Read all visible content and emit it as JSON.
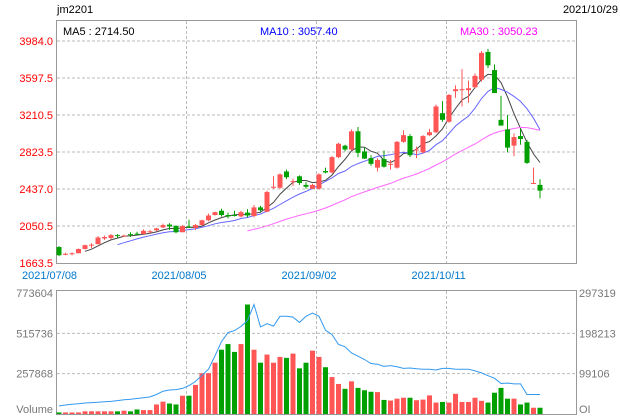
{
  "header": {
    "symbol": "jm2201",
    "date": "2021/10/29"
  },
  "legend": {
    "ma5": "MA5 : 2714.50",
    "ma10": "MA10 : 3057.40",
    "ma30": "MA30 : 3050.23"
  },
  "colors": {
    "up": "#ff5555",
    "down": "#00a000",
    "ma5": "#444444",
    "ma10": "#6666ff",
    "ma30": "#ff66ff",
    "oi": "#3399ee",
    "price_tick": "#ff0000",
    "date_tick": "#0077cc",
    "vol_tick": "#777777"
  },
  "chart_data": [
    {
      "type": "candlestick",
      "title": "jm2201",
      "ylim": [
        1663.5,
        3984.0
      ],
      "y_ticks": [
        "3984.0",
        "3597.5",
        "3210.5",
        "2823.5",
        "2437.0",
        "2050.5",
        "1663.5"
      ],
      "x_ticks": [
        {
          "label": "2021/07/08",
          "index": 0
        },
        {
          "label": "2021/08/05",
          "index": 20
        },
        {
          "label": "2021/09/02",
          "index": 40
        },
        {
          "label": "2021/10/11",
          "index": 60
        }
      ],
      "grid": true,
      "ma_periods": [
        5,
        10,
        30
      ],
      "ohlc": [
        [
          1830,
          1840,
          1735,
          1745
        ],
        [
          1755,
          1770,
          1745,
          1760
        ],
        [
          1758,
          1775,
          1745,
          1765
        ],
        [
          1765,
          1815,
          1765,
          1810
        ],
        [
          1810,
          1855,
          1805,
          1850
        ],
        [
          1848,
          1870,
          1820,
          1855
        ],
        [
          1860,
          1945,
          1860,
          1930
        ],
        [
          1920,
          1950,
          1905,
          1935
        ],
        [
          1925,
          1965,
          1910,
          1955
        ],
        [
          1955,
          1965,
          1925,
          1945
        ],
        [
          1945,
          1960,
          1940,
          1950
        ],
        [
          1965,
          1985,
          1935,
          1960
        ],
        [
          1970,
          1990,
          1955,
          1965
        ],
        [
          1965,
          2015,
          1965,
          2000
        ],
        [
          1985,
          2010,
          1975,
          1995
        ],
        [
          2005,
          2030,
          1995,
          2025
        ],
        [
          2035,
          2075,
          2030,
          2060
        ],
        [
          2065,
          2080,
          2010,
          2045
        ],
        [
          2050,
          2060,
          1975,
          1985
        ],
        [
          1985,
          2060,
          1985,
          2050
        ],
        [
          2045,
          2115,
          2030,
          2040
        ],
        [
          2030,
          2070,
          2010,
          2060
        ],
        [
          2060,
          2115,
          2055,
          2110
        ],
        [
          2110,
          2180,
          2100,
          2160
        ],
        [
          2165,
          2200,
          2160,
          2195
        ],
        [
          2210,
          2230,
          2150,
          2165
        ],
        [
          2165,
          2190,
          2130,
          2150
        ],
        [
          2165,
          2210,
          2150,
          2160
        ],
        [
          2150,
          2210,
          2140,
          2195
        ],
        [
          2190,
          2225,
          2140,
          2160
        ],
        [
          2155,
          2270,
          2140,
          2245
        ],
        [
          2245,
          2260,
          2200,
          2215
        ],
        [
          2200,
          2420,
          2195,
          2405
        ],
        [
          2455,
          2570,
          2440,
          2460
        ],
        [
          2450,
          2600,
          2440,
          2590
        ],
        [
          2620,
          2640,
          2540,
          2560
        ],
        [
          2515,
          2545,
          2470,
          2520
        ],
        [
          2570,
          2580,
          2480,
          2500
        ],
        [
          2480,
          2510,
          2440,
          2460
        ],
        [
          2440,
          2490,
          2440,
          2480
        ],
        [
          2440,
          2600,
          2430,
          2590
        ],
        [
          2625,
          2660,
          2600,
          2610
        ],
        [
          2610,
          2780,
          2600,
          2770
        ],
        [
          2770,
          2920,
          2760,
          2910
        ],
        [
          2890,
          2900,
          2830,
          2850
        ],
        [
          2850,
          3060,
          2840,
          3040
        ],
        [
          3040,
          3085,
          2770,
          2815
        ],
        [
          2830,
          2870,
          2750,
          2755
        ],
        [
          2760,
          2790,
          2680,
          2700
        ],
        [
          2660,
          2760,
          2620,
          2740
        ],
        [
          2750,
          2840,
          2660,
          2670
        ],
        [
          2690,
          2740,
          2640,
          2700
        ],
        [
          2660,
          2940,
          2650,
          2930
        ],
        [
          2930,
          3050,
          2920,
          3000
        ],
        [
          2990,
          3010,
          2770,
          2790
        ],
        [
          2845,
          2880,
          2760,
          2850
        ],
        [
          2820,
          3000,
          2810,
          2990
        ],
        [
          3000,
          3065,
          2990,
          3030
        ],
        [
          3030,
          3320,
          3020,
          3300
        ],
        [
          3230,
          3355,
          3140,
          3160
        ],
        [
          3140,
          3430,
          3130,
          3420
        ],
        [
          3460,
          3520,
          3390,
          3480
        ],
        [
          3470,
          3690,
          3300,
          3480
        ],
        [
          3470,
          3570,
          3340,
          3490
        ],
        [
          3500,
          3645,
          3490,
          3620
        ],
        [
          3580,
          3880,
          3560,
          3860
        ],
        [
          3870,
          3900,
          3700,
          3730
        ],
        [
          3680,
          3740,
          3440,
          3440
        ],
        [
          3160,
          3410,
          3100,
          3100
        ],
        [
          3060,
          3210,
          2820,
          2870
        ],
        [
          2890,
          3020,
          2780,
          2980
        ],
        [
          2990,
          3070,
          2900,
          2960
        ],
        [
          2930,
          2950,
          2700,
          2710
        ],
        [
          2490,
          2660,
          2490,
          2500
        ],
        [
          2480,
          2540,
          2340,
          2420
        ]
      ]
    },
    {
      "type": "bar",
      "title": "Volume",
      "ylabel_left": "Volume",
      "ylabel_right": "OI",
      "ylim_volume": [
        0,
        773604
      ],
      "ylim_oi": [
        0,
        297319
      ],
      "y_ticks_left": [
        "773604",
        "515736",
        "257868"
      ],
      "y_ticks_right": [
        "297319",
        "198213",
        "99106"
      ],
      "volume": [
        10000,
        10000,
        10000,
        10000,
        17000,
        17000,
        17000,
        17000,
        17000,
        17000,
        21000,
        17000,
        29000,
        25000,
        25000,
        61000,
        79000,
        67000,
        61000,
        117000,
        117000,
        186000,
        261000,
        261000,
        328000,
        411000,
        447000,
        397000,
        447000,
        700000,
        411000,
        328000,
        380000,
        328000,
        365000,
        359000,
        386000,
        292000,
        328000,
        405000,
        365000,
        299000,
        236000,
        192000,
        161000,
        209000,
        167000,
        152000,
        142000,
        140000,
        90000,
        86000,
        98000,
        104000,
        104000,
        88000,
        92000,
        119000,
        73000,
        77000,
        73000,
        129000,
        77000,
        77000,
        104000,
        84000,
        73000,
        136000,
        167000,
        98000,
        98000,
        61000,
        73000,
        40000,
        40000
      ],
      "open_interest": [
        20000,
        22000,
        24000,
        25000,
        27000,
        28000,
        29000,
        30000,
        31000,
        33000,
        35000,
        36000,
        38000,
        40000,
        42000,
        48000,
        56000,
        59000,
        60000,
        63000,
        70000,
        80000,
        95000,
        110000,
        143000,
        178000,
        200000,
        205000,
        215000,
        230000,
        269000,
        214000,
        222000,
        216000,
        240000,
        240000,
        238000,
        225000,
        240000,
        248000,
        240000,
        206000,
        195000,
        171000,
        165000,
        150000,
        142000,
        134000,
        124000,
        122000,
        117000,
        119000,
        116000,
        112000,
        113000,
        111000,
        110000,
        110000,
        108000,
        112000,
        112000,
        110000,
        110000,
        110000,
        106000,
        101000,
        94000,
        88000,
        75000,
        76000,
        74000,
        74000,
        48000,
        48000,
        48000
      ]
    }
  ]
}
